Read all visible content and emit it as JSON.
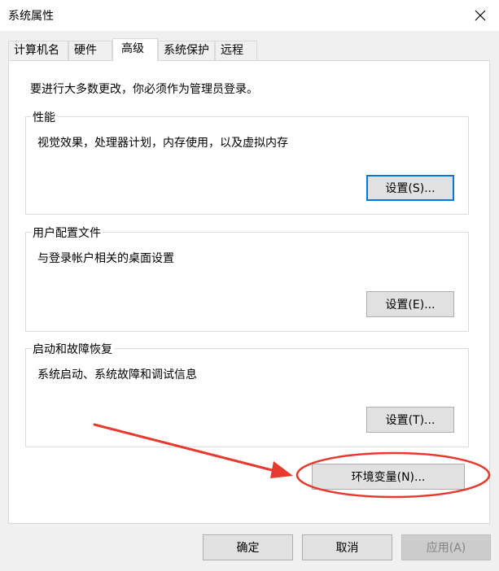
{
  "window": {
    "title": "系统属性"
  },
  "tabs": [
    {
      "label": "计算机名"
    },
    {
      "label": "硬件"
    },
    {
      "label": "高级"
    },
    {
      "label": "系统保护"
    },
    {
      "label": "远程"
    }
  ],
  "intro": "要进行大多数更改，你必须作为管理员登录。",
  "groups": {
    "performance": {
      "title": "性能",
      "description": "视觉效果，处理器计划，内存使用，以及虚拟内存",
      "button": "设置(S)..."
    },
    "user_profiles": {
      "title": "用户配置文件",
      "description": "与登录帐户相关的桌面设置",
      "button": "设置(E)..."
    },
    "startup_recovery": {
      "title": "启动和故障恢复",
      "description": "系统启动、系统故障和调试信息",
      "button": "设置(T)..."
    }
  },
  "env_button": "环境变量(N)...",
  "footer": {
    "ok": "确定",
    "cancel": "取消",
    "apply": "应用(A)"
  },
  "colors": {
    "annotation": "#e8392f",
    "focus": "#0078d7"
  },
  "icons": {
    "close": "close-icon"
  }
}
